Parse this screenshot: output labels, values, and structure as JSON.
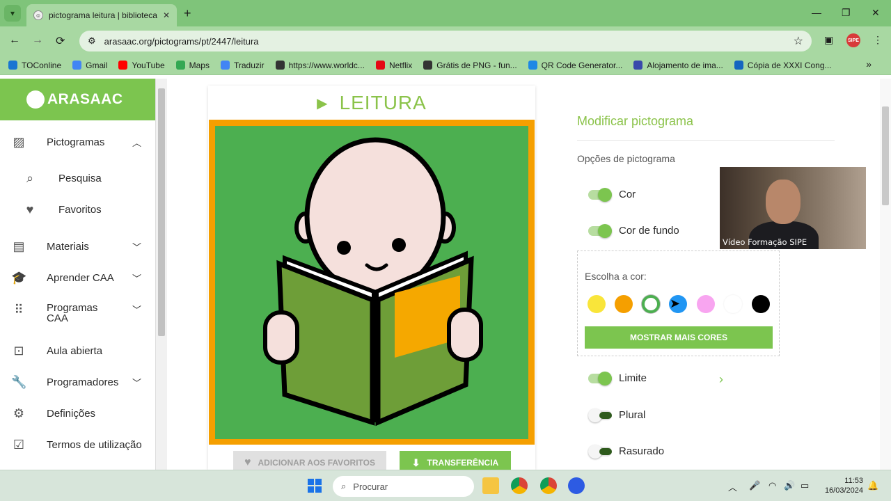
{
  "browser": {
    "tab_title": "pictograma leitura | biblioteca d",
    "tab_close": "✕",
    "new_tab": "+",
    "url": "arasaac.org/pictograms/pt/2447/leitura",
    "profile_badge": "SIPE",
    "win_min": "—",
    "win_max": "❐",
    "win_close": "✕"
  },
  "bookmarks": [
    {
      "label": "TOConline",
      "color": "#1976d2"
    },
    {
      "label": "Gmail",
      "color": "#4285f4"
    },
    {
      "label": "YouTube",
      "color": "#ff0000"
    },
    {
      "label": "Maps",
      "color": "#34a853"
    },
    {
      "label": "Traduzir",
      "color": "#4285f4"
    },
    {
      "label": "https://www.worldc...",
      "color": "#333333"
    },
    {
      "label": "Netflix",
      "color": "#e50914"
    },
    {
      "label": "Grátis de PNG - fun...",
      "color": "#333333"
    },
    {
      "label": "QR Code Generator...",
      "color": "#1e88e5"
    },
    {
      "label": "Alojamento de ima...",
      "color": "#3949ab"
    },
    {
      "label": "Cópia de XXXI Cong...",
      "color": "#1565c0"
    }
  ],
  "sidebar": {
    "logo": "ARASAAC",
    "items": [
      {
        "label": "Pictogramas",
        "icon": "image-icon"
      },
      {
        "label": "Pesquisa",
        "icon": "search-icon"
      },
      {
        "label": "Favoritos",
        "icon": "heart-icon"
      },
      {
        "label": "Materiais",
        "icon": "library-icon"
      },
      {
        "label": "Aprender CAA",
        "icon": "school-icon"
      },
      {
        "label": "Programas CAA",
        "icon": "apps-icon"
      },
      {
        "label": "Aula abierta",
        "icon": "classroom-icon"
      },
      {
        "label": "Programadores",
        "icon": "wrench-icon"
      },
      {
        "label": "Definições",
        "icon": "gear-icon"
      },
      {
        "label": "Termos de utilização",
        "icon": "checklist-icon"
      }
    ]
  },
  "pictogram": {
    "title": "LEITURA",
    "border_color": "#f59f00",
    "bg_color": "#4caf50",
    "fav_button": "ADICIONAR AOS FAVORITOS",
    "download_button": "TRANSFERÊNCIA"
  },
  "panel": {
    "title": "Modificar pictograma",
    "subtitle": "Opções de pictograma",
    "toggles": [
      {
        "label": "Cor",
        "on": true
      },
      {
        "label": "Cor de fundo",
        "on": true
      },
      {
        "label": "Limite",
        "on": true
      },
      {
        "label": "Plural",
        "on": false
      },
      {
        "label": "Rasurado",
        "on": false
      }
    ],
    "color_label": "Escolha a cor:",
    "swatches": [
      "#f9e53a",
      "#f59f00",
      "#4caf50",
      "#2196f3",
      "#f8a5f0",
      "#ffffff",
      "#000000"
    ],
    "more_colors": "MOSTRAR MAIS CORES",
    "limit_arrow": "›"
  },
  "video": {
    "caption": "Vídeo Formação SIPE"
  },
  "taskbar": {
    "search_placeholder": "Procurar",
    "time": "11:53",
    "date": "16/03/2024"
  }
}
